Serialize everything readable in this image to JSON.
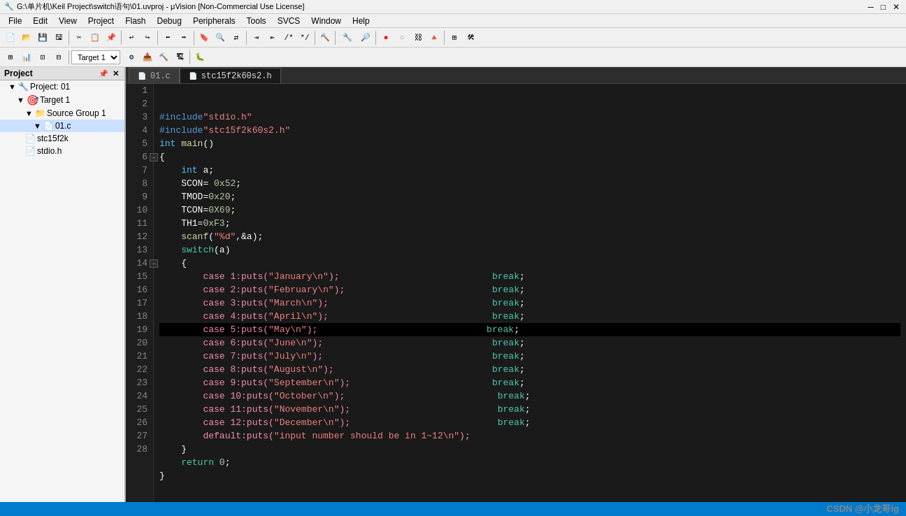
{
  "titlebar": {
    "title": "G:\\单片机\\Keil Project\\switch语句\\01.uvproj - μVision  [Non-Commercial Use License]",
    "minimize": "─",
    "maximize": "□",
    "close": "✕"
  },
  "menubar": {
    "items": [
      "File",
      "Edit",
      "View",
      "Project",
      "Flash",
      "Debug",
      "Peripherals",
      "Tools",
      "SVCS",
      "Window",
      "Help"
    ]
  },
  "toolbar2": {
    "target": "Target 1"
  },
  "project_panel": {
    "header": "Project",
    "tree": [
      {
        "level": 0,
        "icon": "🖥",
        "label": "Project: 01",
        "expanded": true
      },
      {
        "level": 1,
        "icon": "📁",
        "label": "Target 1",
        "expanded": true
      },
      {
        "level": 2,
        "icon": "📂",
        "label": "Source Group 1",
        "expanded": true
      },
      {
        "level": 3,
        "icon": "📄",
        "label": "01.c",
        "active": true
      },
      {
        "level": 2,
        "icon": "📄",
        "label": "stc15f2k",
        "expanded": false
      },
      {
        "level": 2,
        "icon": "📄",
        "label": "stdio.h"
      }
    ]
  },
  "tabs": [
    {
      "id": "01c",
      "label": "01.c",
      "active": false
    },
    {
      "id": "stc15f2k60s2h",
      "label": "stc15f2k60s2.h",
      "active": true
    }
  ],
  "code": {
    "lines": [
      {
        "num": 1,
        "content": "#include\"stdio.h\""
      },
      {
        "num": 2,
        "content": "#include\"stc15f2k60s2.h\""
      },
      {
        "num": 3,
        "content": "int main()"
      },
      {
        "num": 4,
        "content": "{",
        "collapse": true
      },
      {
        "num": 5,
        "content": "    int a;"
      },
      {
        "num": 6,
        "content": "    SCON= 0x52;"
      },
      {
        "num": 7,
        "content": "    TMOD=0x20;"
      },
      {
        "num": 8,
        "content": "    TCON=0X69;"
      },
      {
        "num": 9,
        "content": "    TH1=0xF3;"
      },
      {
        "num": 10,
        "content": "    scanf(\"%d\",&a);"
      },
      {
        "num": 11,
        "content": "    switch(a)"
      },
      {
        "num": 12,
        "content": "    {",
        "collapse": true
      },
      {
        "num": 13,
        "content": "        case 1:puts(\"January\\n\");                     break;"
      },
      {
        "num": 14,
        "content": "        case 2:puts(\"February\\n\");                    break;"
      },
      {
        "num": 15,
        "content": "        case 3:puts(\"March\\n\");                       break;"
      },
      {
        "num": 16,
        "content": "        case 4:puts(\"April\\n\");                       break;"
      },
      {
        "num": 17,
        "content": "        case 5:puts(\"May\\n\");                         break;",
        "highlighted": true
      },
      {
        "num": 18,
        "content": "        case 6:puts(\"June\\n\");                        break;"
      },
      {
        "num": 19,
        "content": "        case 7:puts(\"July\\n\");                        break;"
      },
      {
        "num": 20,
        "content": "        case 8:puts(\"August\\n\");                      break;"
      },
      {
        "num": 21,
        "content": "        case 9:puts(\"September\\n\");                   break;"
      },
      {
        "num": 22,
        "content": "        case 10:puts(\"October\\n\");                    break;"
      },
      {
        "num": 23,
        "content": "        case 11:puts(\"November\\n\");                   break;"
      },
      {
        "num": 24,
        "content": "        case 12:puts(\"December\\n\");                   break;"
      },
      {
        "num": 25,
        "content": "        default:puts(\"input number should be in 1~12\\n\");"
      },
      {
        "num": 26,
        "content": "    }"
      },
      {
        "num": 27,
        "content": "    return 0;"
      },
      {
        "num": 28,
        "content": "}"
      }
    ]
  },
  "watermark": "CSDN @小龙哥lg",
  "statusbar": {}
}
